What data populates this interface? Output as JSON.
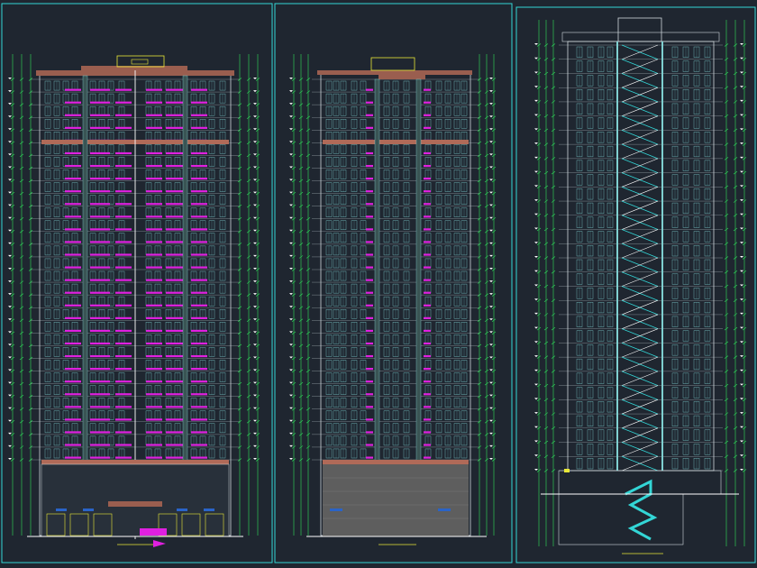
{
  "colors": {
    "background": "#1f2630",
    "frame": "#33d6d6",
    "dimension": "#2fe05a",
    "floor_line": "#d9e6ea",
    "window": "#7fd0d0",
    "balcony": "#e020e0",
    "cornice": "#b06a58",
    "stair": "#33d6d6",
    "label_box": "#e8e838",
    "stone_base": "#6a6a6a"
  },
  "icons": {
    "title_marker": "title-arrow-icon",
    "level_marker": "level-triangle-icon"
  },
  "drawings": [
    {
      "id": "front-elevation",
      "floors": 30,
      "has_balconies": true,
      "has_stair_core": false
    },
    {
      "id": "side-elevation",
      "floors": 30,
      "has_balconies": true,
      "has_stair_core": false
    },
    {
      "id": "section",
      "floors": 30,
      "has_balconies": false,
      "has_stair_core": true
    }
  ]
}
